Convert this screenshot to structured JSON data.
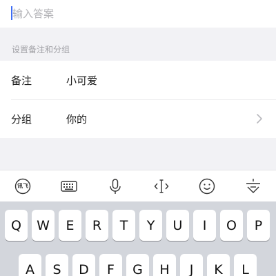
{
  "answer": {
    "placeholder": "输入答案",
    "value": ""
  },
  "section": {
    "title": "设置备注和分组"
  },
  "rows": [
    {
      "label": "备注",
      "value": "小可爱"
    },
    {
      "label": "分组",
      "value": "你的"
    }
  ],
  "toolbar": {
    "icons": [
      "xunfei-logo-icon",
      "keyboard-icon",
      "microphone-icon",
      "cursor-move-icon",
      "emoji-icon",
      "collapse-keyboard-icon"
    ],
    "logo_text": "讯飞"
  },
  "keyboard": {
    "row1": [
      "Q",
      "W",
      "E",
      "R",
      "T",
      "Y",
      "U",
      "I",
      "O",
      "P"
    ],
    "row2": [
      "A",
      "S",
      "D",
      "F",
      "G",
      "H",
      "J",
      "K",
      "L"
    ]
  },
  "colors": {
    "caret": "#3e6df5",
    "background": "#f2f2f5",
    "keyboard_bg": "#d3d6dc"
  }
}
